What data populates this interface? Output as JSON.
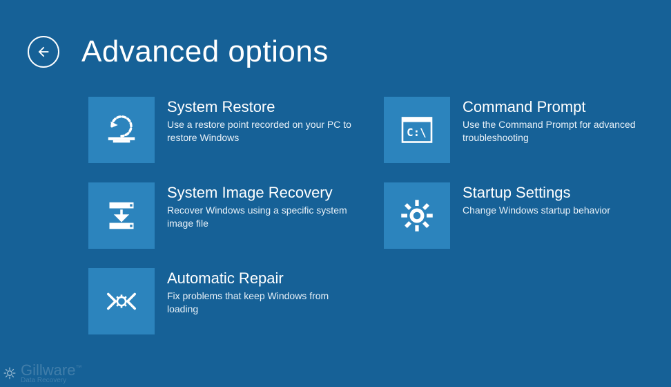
{
  "header": {
    "title": "Advanced options"
  },
  "options": [
    {
      "title": "System Restore",
      "desc": "Use a restore point recorded on your PC to restore Windows"
    },
    {
      "title": "Command Prompt",
      "desc": "Use the Command Prompt for advanced troubleshooting"
    },
    {
      "title": "System Image Recovery",
      "desc": "Recover Windows using a specific system image file"
    },
    {
      "title": "Startup Settings",
      "desc": "Change Windows startup behavior"
    },
    {
      "title": "Automatic Repair",
      "desc": "Fix problems that keep Windows from loading"
    }
  ],
  "watermark": {
    "brand": "Gillware",
    "tagline": "Data Recovery"
  },
  "colors": {
    "background": "#166197",
    "tile": "#2c84bd",
    "text": "#ffffff"
  }
}
